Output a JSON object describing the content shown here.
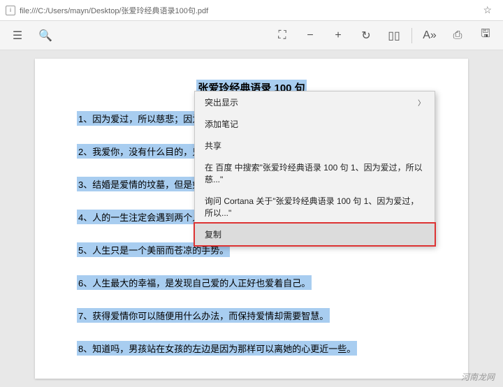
{
  "url": "file:///C:/Users/mayn/Desktop/张爱玲经典语录100句.pdf",
  "document": {
    "title": "张爱玲经典语录 100 句",
    "lines": [
      "1、因为爱过，所以慈悲；因为懂得，所以宽容。",
      "2、我爱你，没有什么目的，只是爱你。",
      "3、结婚是爱情的坟墓，但是如果不结婚，爱情就死无葬身之地。",
      "4、人的一生注定会遇到两个人",
      "5、人生只是一个美丽而苍凉的手势。",
      "6、人生最大的幸福，是发现自己爱的人正好也爱着自己。",
      "7、获得爱情你可以随便用什么办法，而保持爱情却需要智慧。",
      "8、知道吗，男孩站在女孩的左边是因为那样可以离她的心更近一些。"
    ]
  },
  "contextMenu": {
    "highlight": "突出显示",
    "addNote": "添加笔记",
    "share": "共享",
    "searchBaidu": "在 百度 中搜索\"张爱玲经典语录 100 句 1、因为爱过，所以慈...\"",
    "askCortana": "询问 Cortana 关于\"张爱玲经典语录 100 句 1、因为爱过，所以...\"",
    "copy": "复制"
  },
  "watermark": "河南龙网"
}
